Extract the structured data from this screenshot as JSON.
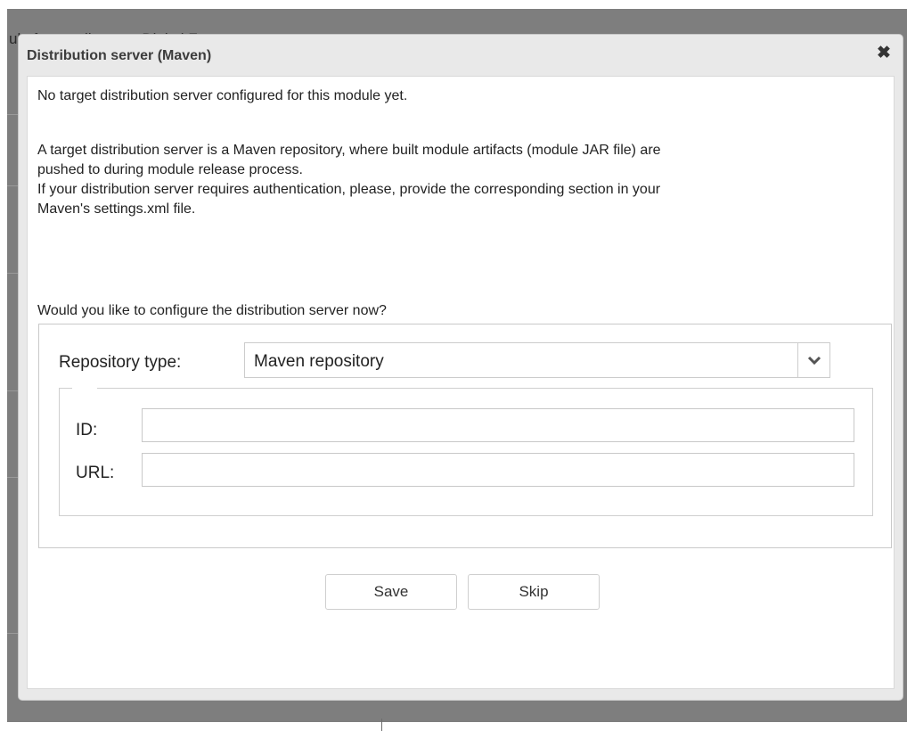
{
  "background": {
    "partial_text": "ule for sending to a Digital Factory serve"
  },
  "dialog": {
    "title": "Distribution server (Maven)",
    "close_icon": "close-icon",
    "messages": {
      "no_target": "No target distribution server configured for this module yet.",
      "description_line1": "A target distribution server is a Maven repository, where built module artifacts (module JAR file) are",
      "description_line2": "pushed to during module release process.",
      "auth_line1": "If your distribution server requires authentication, please, provide the corresponding section in your",
      "auth_line2": "Maven's settings.xml file.",
      "question": "Would you like to configure the distribution server now?"
    },
    "form": {
      "repository_type_label": "Repository type:",
      "repository_type_value": "Maven repository",
      "id_label": "ID:",
      "id_value": "",
      "url_label": "URL:",
      "url_value": ""
    },
    "buttons": {
      "save": "Save",
      "skip": "Skip"
    }
  }
}
